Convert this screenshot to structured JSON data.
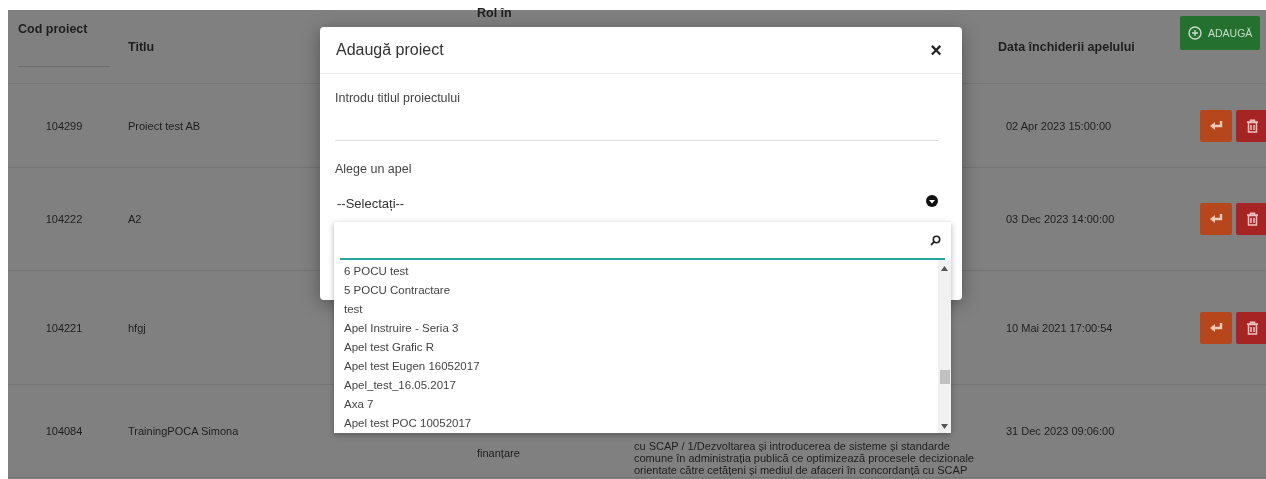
{
  "table": {
    "header": {
      "code": "Cod proiect",
      "title": "Titlu",
      "role": "Rol în",
      "closing_date": "Data închiderii apelului",
      "add_button": "ADAUGĂ"
    },
    "rows": [
      {
        "code": "104299",
        "title": "Proiect test AB",
        "closing_date": "02 Apr 2023 15:00:00",
        "has_actions": true
      },
      {
        "code": "104222",
        "title": "A2",
        "closing_date": "03 Dec 2023 14:00:00",
        "has_actions": true
      },
      {
        "code": "104221",
        "title": "hfgj",
        "closing_date": "10 Mai 2021 17:00:54",
        "has_actions": true
      },
      {
        "code": "104084",
        "title": "TrainingPOCA Simona",
        "role": "finanțare",
        "description": [
          "cu SCAP / 1/Dezvoltarea și introducerea de sisteme și standarde",
          "comune în administrația publică ce optimizează procesele decizionale",
          "orientate către cetățeni și mediul de afaceri în concordanță cu SCAP"
        ],
        "closing_date": "31 Dec 2023 09:06:00",
        "has_actions": false
      }
    ]
  },
  "modal": {
    "title": "Adaugă proiect",
    "close": "×",
    "title_field": {
      "label": "Introdu titlul proiectului"
    },
    "call_select": {
      "label": "Alege un apel",
      "value": "--Selectați--",
      "expanded": true
    },
    "dropdown": {
      "options": [
        {
          "label": "6 POCU test",
          "selected": false
        },
        {
          "label": "5 POCU Contractare",
          "selected": false
        },
        {
          "label": "test",
          "selected": false
        },
        {
          "label": "Apel Instruire - Seria 3",
          "selected": false
        },
        {
          "label": "Apel test Grafic R",
          "selected": false
        },
        {
          "label": "Apel test Eugen 16052017",
          "selected": false
        },
        {
          "label": "Apel_test_16.05.2017",
          "selected": false
        },
        {
          "label": "Axa 7",
          "selected": false
        },
        {
          "label": "Apel test POC 10052017",
          "selected": false
        }
      ]
    }
  }
}
